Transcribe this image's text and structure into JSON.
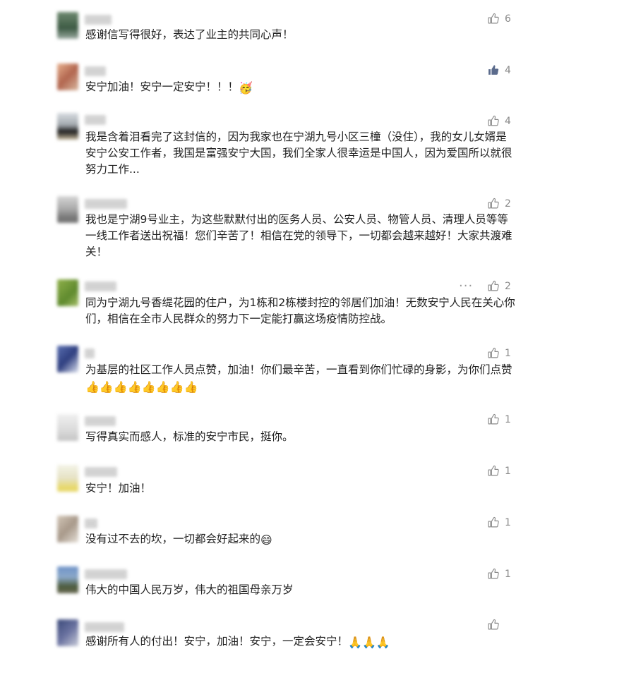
{
  "comments": [
    {
      "text": "感谢信写得很好，表达了业主的共同心声！",
      "likes": "6",
      "liked": false
    },
    {
      "text": "安宁加油！安宁一定安宁！！！",
      "emoji": "🥳",
      "likes": "4",
      "liked": true
    },
    {
      "text": "我是含着泪看完了这封信的，因为我家也在宁湖九号小区三橦（没住），我的女儿女婿是安宁公安工作者，我国是富强安宁大国，我们全家人很幸运是中国人，因为爱国所以就很努力工作...",
      "likes": "4",
      "liked": false
    },
    {
      "text": "我也是宁湖9号业主，为这些默默付出的医务人员、公安人员、物管人员、清理人员等等一线工作者送出祝福！您们辛苦了！相信在党的领导下，一切都会越来越好！大家共渡难关！",
      "likes": "2",
      "liked": false
    },
    {
      "text": "同为宁湖九号香缇花园的住户，为1栋和2栋楼封控的邻居们加油！无数安宁人民在关心你们，相信在全市人民群众的努力下一定能打赢这场疫情防控战。",
      "likes": "2",
      "liked": false,
      "more": "···"
    },
    {
      "text": "为基层的社区工作人员点赞，加油！你们最辛苦，一直看到你们忙碌的身影，为你们点赞",
      "emoji": "👍👍👍👍👍👍👍👍",
      "likes": "1",
      "liked": false
    },
    {
      "text": "写得真实而感人，标准的安宁市民，挺你。",
      "likes": "1",
      "liked": false
    },
    {
      "text": "安宁！加油！",
      "likes": "1",
      "liked": false
    },
    {
      "text": "没有过不去的坎，一切都会好起来的",
      "emoji": "😄",
      "likes": "1",
      "liked": false
    },
    {
      "text": "伟大的中国人民万岁，伟大的祖国母亲万岁",
      "likes": "1",
      "liked": false
    },
    {
      "text": "感谢所有人的付出！安宁，加油！安宁，一定会安宁！",
      "emoji": "🙏🙏🙏",
      "likes": "",
      "liked": false
    }
  ]
}
